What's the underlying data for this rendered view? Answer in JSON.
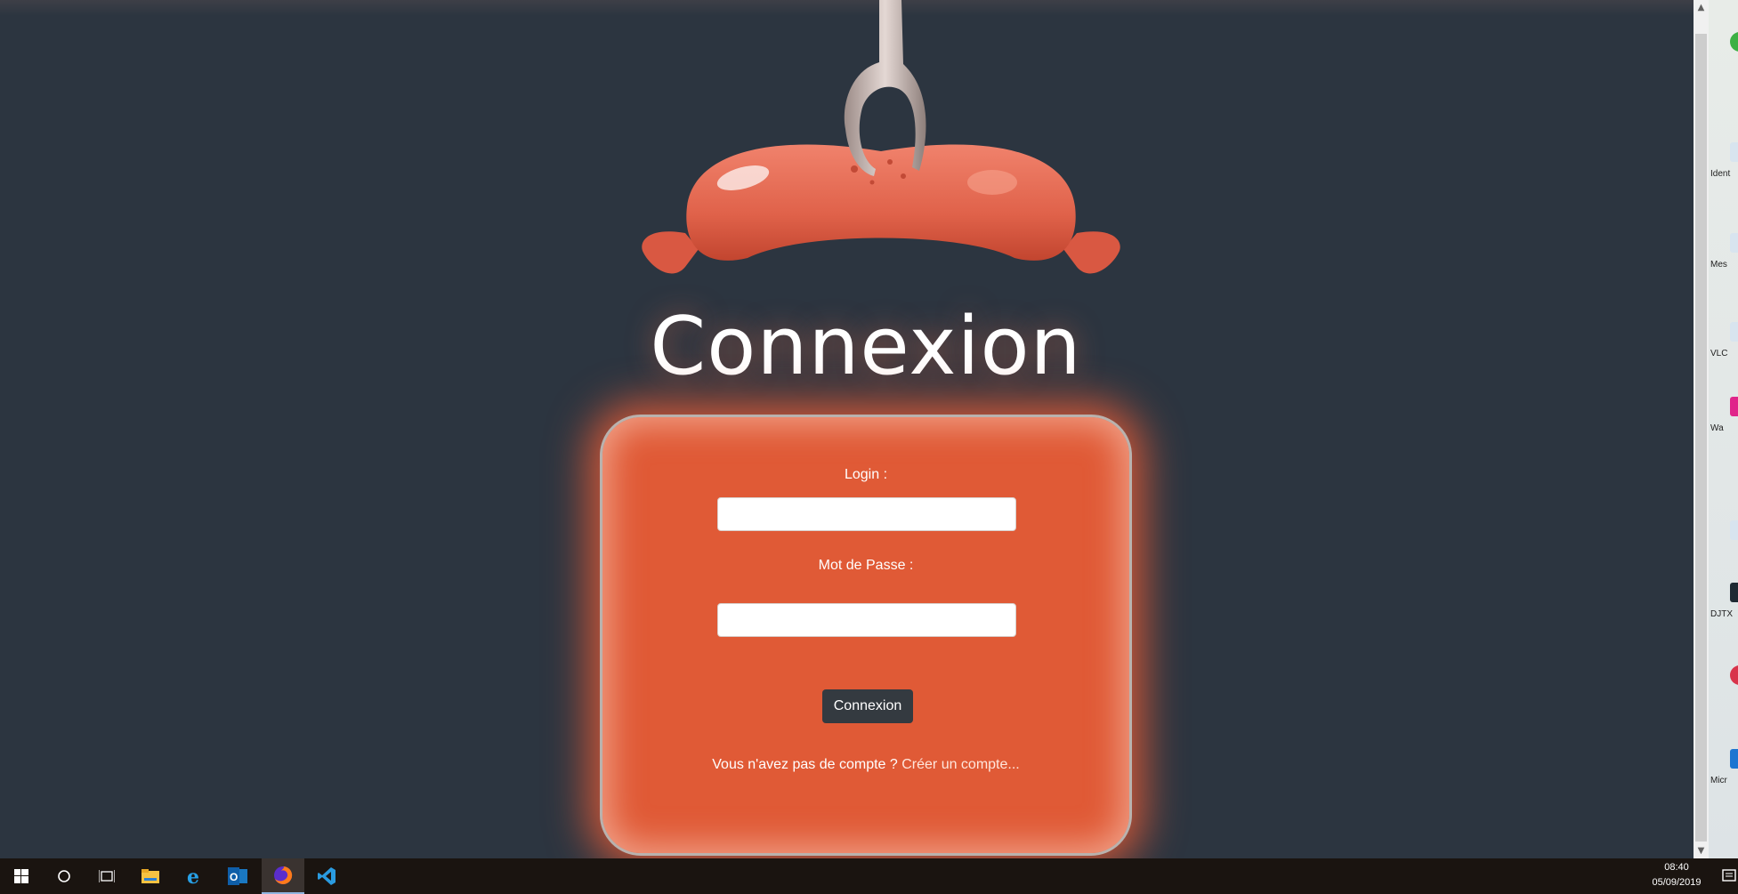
{
  "page": {
    "title": "Connexion",
    "form": {
      "login_label": "Login :",
      "login_value": "",
      "password_label": "Mot de Passe :",
      "password_value": "",
      "submit_label": "Connexion",
      "signup_prompt": "Vous n'avez pas de compte ?",
      "signup_link": "Créer un compte..."
    }
  },
  "colors": {
    "background": "#2c3540",
    "card": "#e05a36",
    "button": "#343a40",
    "sausage": "#e0624a"
  },
  "desktop": {
    "icons": [
      {
        "icon": "app-icon-green",
        "caption": ""
      },
      {
        "icon": "shortcut-icon",
        "caption": "Ident"
      },
      {
        "icon": "shortcut-icon",
        "caption": "Mes"
      },
      {
        "icon": "shortcut-icon",
        "caption": "VLC"
      },
      {
        "icon": "app-icon-pink",
        "caption": "Wa"
      },
      {
        "icon": "shortcut-icon",
        "caption": ""
      },
      {
        "icon": "app-icon-dark",
        "caption": "DJTX"
      },
      {
        "icon": "app-icon-red",
        "caption": ""
      },
      {
        "icon": "app-icon-blue",
        "caption": "Micr"
      }
    ]
  },
  "taskbar": {
    "apps": [
      {
        "icon": "windows-start-icon"
      },
      {
        "icon": "cortana-search-icon"
      },
      {
        "icon": "task-view-icon"
      },
      {
        "icon": "file-explorer-icon"
      },
      {
        "icon": "internet-explorer-icon"
      },
      {
        "icon": "outlook-icon"
      },
      {
        "icon": "firefox-icon",
        "active": true
      },
      {
        "icon": "vscode-icon"
      }
    ],
    "time": "08:40",
    "date": "05/09/2019"
  }
}
